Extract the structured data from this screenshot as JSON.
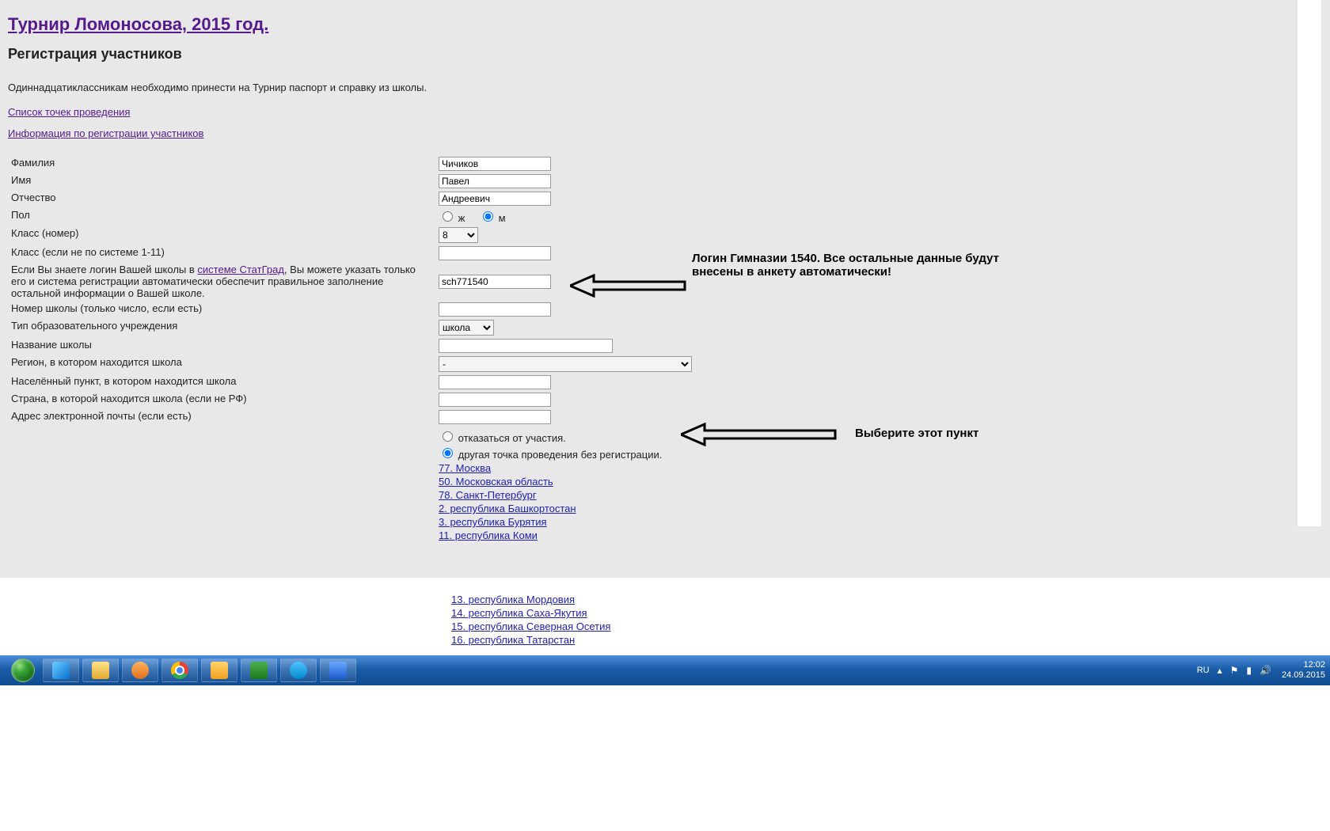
{
  "header": {
    "title": "Турнир Ломоносова, 2015 год.",
    "subtitle": "Регистрация участников",
    "note": "Одиннадцатиклассникам необходимо принести на Турнир паспорт и справку из школы.",
    "link_points": "Список точек проведения",
    "link_info": "Информация по регистрации участников"
  },
  "form": {
    "labels": {
      "surname": "Фамилия",
      "name": "Имя",
      "patronymic": "Отчество",
      "gender": "Пол",
      "class_num": "Класс (номер)",
      "class_alt": "Класс (если не по системе 1-11)",
      "login_pre": "Если Вы знаете логин Вашей школы в ",
      "login_link": "системе СтатГрад",
      "login_post": ", Вы можете указать только его и система регистрации автоматически обеспечит правильное заполнение остальной информации о Вашей школе.",
      "school_num": "Номер школы (только число, если есть)",
      "school_type": "Тип образовательного учреждения",
      "school_name": "Название школы",
      "region": "Регион, в котором находится школа",
      "city": "Населённый пункт, в котором находится школа",
      "country": "Страна, в которой находится школа (если не РФ)",
      "email": "Адрес электронной почты (если есть)"
    },
    "values": {
      "surname": "Чичиков",
      "name": "Павел",
      "patronymic": "Андреевич",
      "gender_f": "ж",
      "gender_m": "м",
      "class_selected": "8",
      "login": "sch771540",
      "type_selected": "школа",
      "region_selected": "-"
    },
    "radio_opts": {
      "refuse": "отказаться от участия.",
      "other_point": "другая точка проведения без регистрации."
    },
    "regions_upper": [
      "77. Москва",
      "50. Московская область",
      "78. Санкт-Петербург",
      "2. республика Башкортостан",
      "3. республика Бурятия",
      "11. республика Коми"
    ],
    "regions_lower": [
      "13. республика Мордовия",
      "14. республика Саха-Якутия",
      "15. республика Северная Осетия",
      "16. республика Татарстан"
    ]
  },
  "annotations": {
    "login_note": "Логин Гимназии 1540. Все остальные данные будут внесены в анкету автоматически!",
    "radio_note": "Выберите этот пункт"
  },
  "taskbar": {
    "lang": "RU",
    "time": "12:02",
    "date": "24.09.2015"
  }
}
